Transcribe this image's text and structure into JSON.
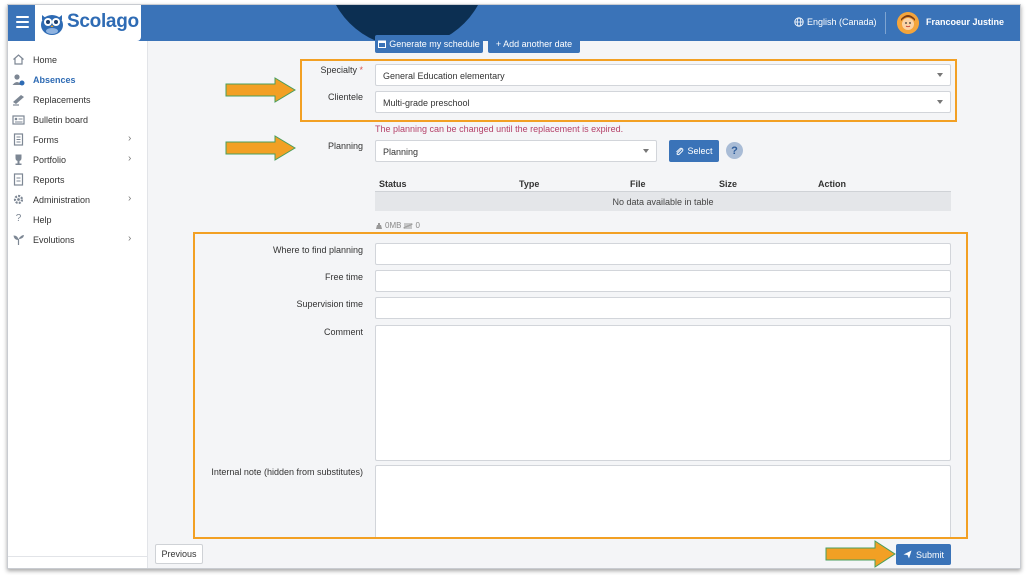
{
  "app": {
    "brand": "Scolago",
    "language": "English (Canada)",
    "user_name": "Francoeur Justine"
  },
  "sidebar": {
    "items": [
      {
        "label": "Home",
        "icon": "home-icon"
      },
      {
        "label": "Absences",
        "icon": "absences-icon",
        "active": true
      },
      {
        "label": "Replacements",
        "icon": "replacements-icon"
      },
      {
        "label": "Bulletin board",
        "icon": "bulletin-board-icon"
      },
      {
        "label": "Forms",
        "icon": "forms-icon",
        "has_children": true
      },
      {
        "label": "Portfolio",
        "icon": "trophy-icon",
        "has_children": true
      },
      {
        "label": "Reports",
        "icon": "reports-icon"
      },
      {
        "label": "Administration",
        "icon": "gear-icon",
        "has_children": true
      },
      {
        "label": "Help",
        "icon": "question-icon"
      },
      {
        "label": "Evolutions",
        "icon": "sprout-icon",
        "has_children": true
      }
    ]
  },
  "actions": {
    "generate_schedule": "Generate my schedule",
    "add_date": "+ Add another date"
  },
  "form": {
    "specialty_label": "Specialty",
    "specialty_required": "*",
    "specialty_value": "General Education elementary",
    "clientele_label": "Clientele",
    "clientele_value": "Multi-grade preschool",
    "planning_note": "The planning can be changed until the replacement is expired.",
    "planning_label": "Planning",
    "planning_value": "Planning",
    "select_button": "Select",
    "help_symbol": "?",
    "where_label": "Where to find planning",
    "free_time_label": "Free time",
    "supervision_label": "Supervision time",
    "comment_label": "Comment",
    "internal_note_label": "Internal note (hidden from substitutes)"
  },
  "table": {
    "columns": [
      "Status",
      "Type",
      "File",
      "Size",
      "Action"
    ],
    "empty_message": "No data available in table",
    "footer_size": "0MB",
    "footer_count": "0"
  },
  "footer": {
    "previous": "Previous",
    "submit": "Submit"
  },
  "colors": {
    "primary": "#3a73b8",
    "highlight": "#f2a024",
    "note": "#b5426a"
  }
}
